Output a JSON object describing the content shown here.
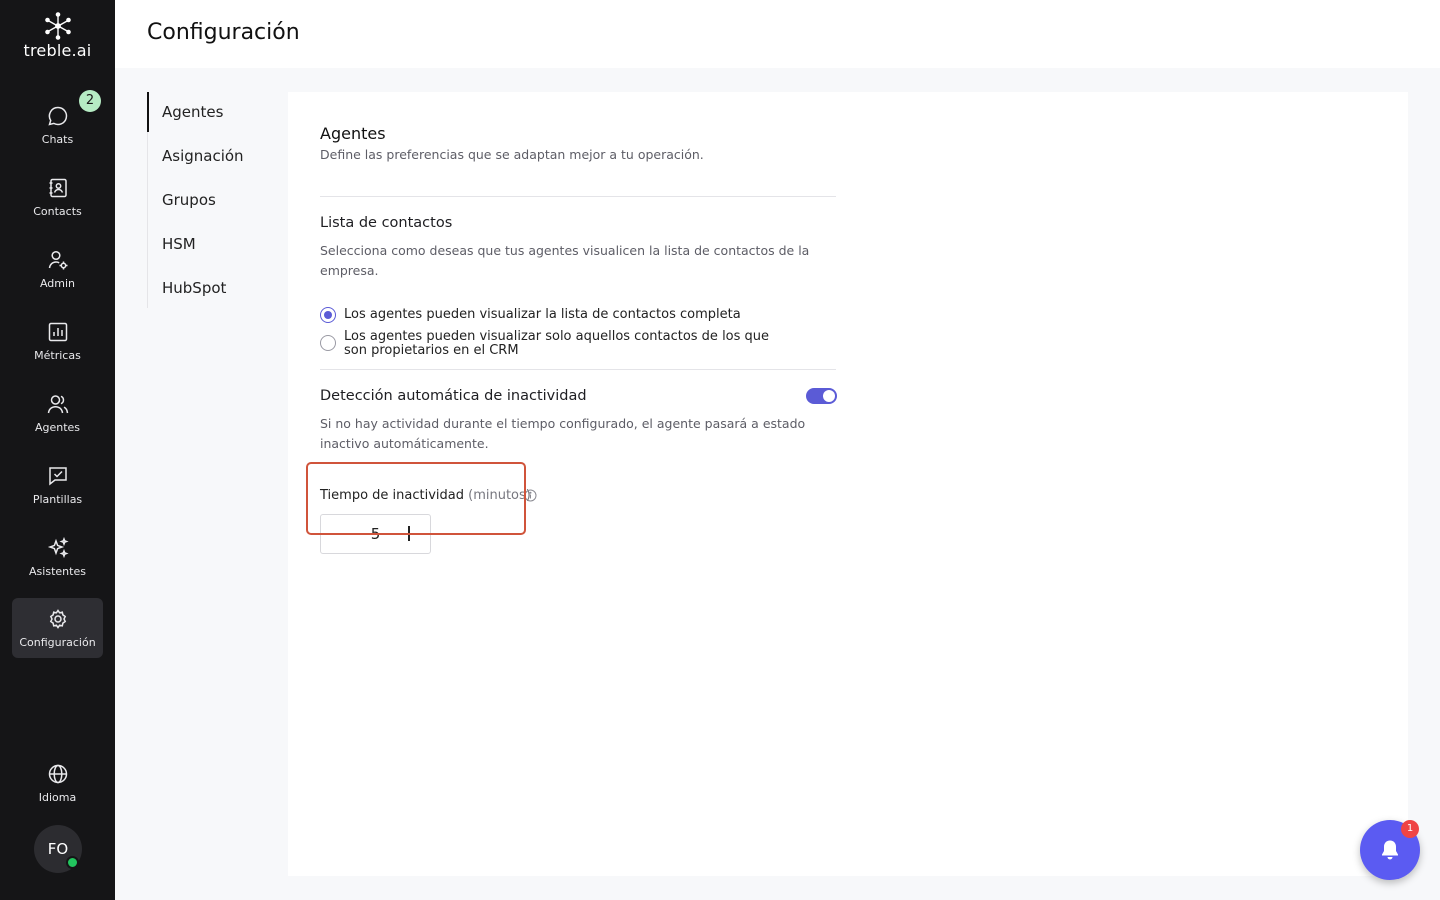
{
  "brand": {
    "name": "treble.ai",
    "logo_icon": "network-logo-icon"
  },
  "sidebar": {
    "items": [
      {
        "label": "Chats",
        "icon": "chat-bubble-icon",
        "badge": "2"
      },
      {
        "label": "Contacts",
        "icon": "contacts-book-icon"
      },
      {
        "label": "Admin",
        "icon": "user-gear-icon"
      },
      {
        "label": "Métricas",
        "icon": "bar-chart-icon"
      },
      {
        "label": "Agentes",
        "icon": "users-icon"
      },
      {
        "label": "Plantillas",
        "icon": "template-check-icon"
      },
      {
        "label": "Asistentes",
        "icon": "sparkles-icon"
      },
      {
        "label": "Configuración",
        "icon": "gear-icon",
        "active": true
      }
    ],
    "language": {
      "label": "Idioma",
      "icon": "globe-icon"
    },
    "avatar": {
      "initials": "FO",
      "status": "online"
    }
  },
  "header": {
    "title": "Configuración"
  },
  "subnav": {
    "items": [
      {
        "label": "Agentes",
        "active": true
      },
      {
        "label": "Asignación"
      },
      {
        "label": "Grupos"
      },
      {
        "label": "HSM"
      },
      {
        "label": "HubSpot"
      }
    ]
  },
  "panel": {
    "title": "Agentes",
    "description": "Define las preferencias que se adaptan mejor a tu operación.",
    "contacts": {
      "title": "Lista de contactos",
      "description": "Selecciona como deseas que tus agentes visualicen la lista de contactos de la empresa.",
      "options": [
        {
          "label": "Los agentes pueden visualizar la lista de contactos completa",
          "checked": true
        },
        {
          "label": "Los agentes pueden visualizar solo aquellos contactos de los que son propietarios en el CRM",
          "checked": false
        }
      ]
    },
    "inactivity": {
      "title": "Detección automática de inactividad",
      "enabled": true,
      "description": "Si no hay actividad durante el tiempo configurado, el agente pasará a estado inactivo automáticamente.",
      "field_label": "Tiempo de inactividad",
      "field_unit": "(minutos)",
      "value": "5"
    }
  },
  "notifications": {
    "count": "1",
    "icon": "bell-icon"
  },
  "colors": {
    "accent": "#5b5bd6",
    "sidebar_bg": "#151517",
    "highlight": "#d0543b",
    "badge_green": "#b6ecc4",
    "notification_red": "#ef4444"
  }
}
